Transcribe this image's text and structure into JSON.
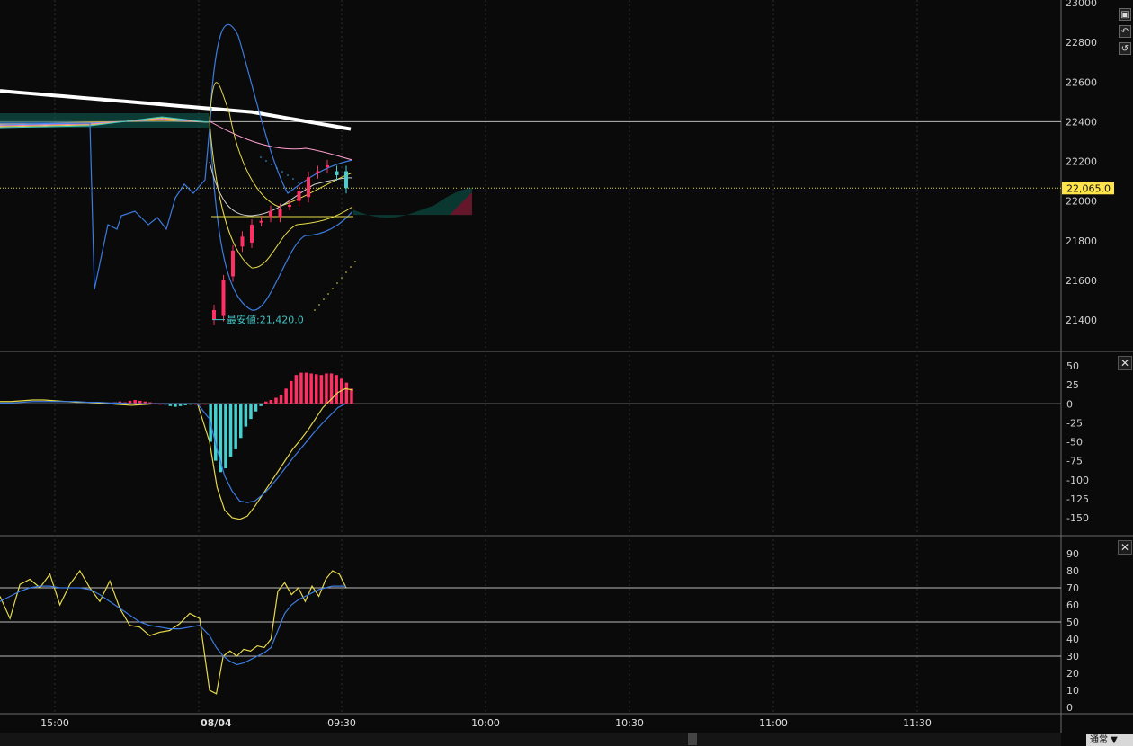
{
  "colors": {
    "background": "#0a0a0a",
    "grid": "#2e2e2e",
    "up_candle": "#ff2e63",
    "down_candle": "#46d0d0",
    "yellow": "#e6d94a",
    "blue": "#3d7be0",
    "white": "#ffffff",
    "pink": "#ff9fd0"
  },
  "price_axis": {
    "ticks": [
      "23000",
      "22800",
      "22600",
      "22400",
      "22200",
      "22000",
      "21800",
      "21600",
      "21400"
    ],
    "current_price_label": "22,065.0",
    "low_annotation": "最安値:21,420.0"
  },
  "macd_axis": {
    "ticks": [
      "50",
      "25",
      "0",
      "-25",
      "-50",
      "-75",
      "-100",
      "-125",
      "-150"
    ]
  },
  "rsi_axis": {
    "ticks": [
      "90",
      "80",
      "70",
      "60",
      "50",
      "40",
      "30",
      "20",
      "10",
      "0"
    ]
  },
  "time_axis": {
    "labels": [
      "15:00",
      "08/04",
      "09:30",
      "10:00",
      "10:30",
      "11:00",
      "11:30"
    ]
  },
  "controls": {
    "close_symbol": "✕",
    "mode_select_value": "通常 ▼"
  },
  "chart_data": [
    {
      "type": "candlestick",
      "title": "",
      "ylim": [
        21300,
        23000
      ],
      "current_price": 22065.0,
      "session_low": 21420.0,
      "horizontal_line": 22400,
      "x_labels": [
        "15:00",
        "08/04",
        "09:30",
        "10:00",
        "10:30",
        "11:00",
        "11:30"
      ],
      "series": [
        {
          "name": "blue_line",
          "values": [
            22380,
            22390,
            22385,
            22395,
            22390,
            21560,
            21880,
            22000,
            22050,
            21900,
            22000,
            22100,
            22150,
            22140,
            22150
          ]
        },
        {
          "name": "closes",
          "values": [
            21450,
            21600,
            21750,
            21820,
            21880,
            21900,
            21950,
            21960,
            21980,
            22050,
            22120,
            22150,
            22180,
            22130,
            22065
          ]
        }
      ]
    },
    {
      "type": "bar",
      "name": "MACD",
      "ylim": [
        -160,
        60
      ],
      "histogram": [
        2,
        3,
        2,
        4,
        5,
        4,
        3,
        2,
        1,
        0,
        -1,
        -3,
        -4,
        -3,
        -2,
        -1,
        0,
        0,
        0,
        -50,
        -75,
        -90,
        -85,
        -70,
        -60,
        -45,
        -30,
        -20,
        -10,
        -3,
        3,
        5,
        8,
        12,
        20,
        30,
        38,
        41,
        41,
        40,
        39,
        38,
        40,
        40,
        38,
        33,
        28,
        20
      ],
      "macd_line": [
        3,
        3,
        4,
        5,
        5,
        4,
        3,
        2,
        2,
        1,
        0,
        -1,
        -2,
        -1,
        0,
        0,
        0,
        0,
        0,
        -50,
        -110,
        -140,
        -150,
        -152,
        -148,
        -135,
        -120,
        -105,
        -90,
        -75,
        -60,
        -48,
        -35,
        -20,
        -5,
        5,
        15,
        20,
        18
      ],
      "signal_line": [
        1,
        1,
        2,
        3,
        3,
        3,
        3,
        3,
        2,
        2,
        1,
        1,
        0,
        0,
        0,
        0,
        0,
        0,
        0,
        -20,
        -60,
        -95,
        -115,
        -128,
        -130,
        -128,
        -120,
        -110,
        -98,
        -85,
        -72,
        -60,
        -48,
        -36,
        -25,
        -15,
        -5,
        0
      ]
    },
    {
      "type": "line",
      "name": "RSI",
      "ylim": [
        0,
        95
      ],
      "reference_lines": [
        70,
        50,
        30
      ],
      "series": [
        {
          "name": "rsi",
          "values": [
            65,
            52,
            72,
            75,
            70,
            78,
            60,
            72,
            80,
            70,
            62,
            74,
            58,
            48,
            47,
            42,
            44,
            45,
            49,
            55,
            52,
            10,
            8,
            30,
            33,
            30,
            34,
            33,
            36,
            35,
            40,
            68,
            73,
            66,
            70,
            62,
            71,
            65,
            75,
            80,
            78,
            70
          ]
        },
        {
          "name": "rsi_ma",
          "values": [
            62,
            65,
            68,
            70,
            71,
            71,
            70,
            70,
            70,
            69,
            66,
            62,
            58,
            54,
            50,
            48,
            47,
            46,
            46,
            47,
            48,
            42,
            35,
            30,
            27,
            25,
            26,
            28,
            30,
            32,
            35,
            45,
            55,
            60,
            63,
            65,
            67,
            69,
            70,
            71,
            71,
            71
          ]
        }
      ]
    }
  ]
}
